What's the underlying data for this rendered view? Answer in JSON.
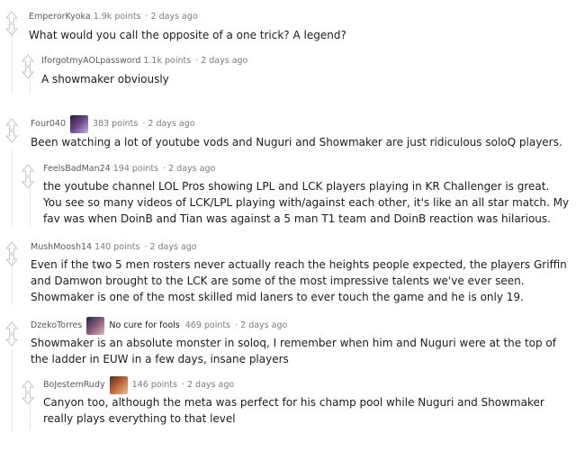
{
  "comments": [
    {
      "author": "EmperorKyoka",
      "points": "1.9k points",
      "time": "2 days ago",
      "lines": [
        "What would you call the opposite of a one trick? A legend?"
      ]
    },
    {
      "author": "IforgotmyAOLpassword",
      "points": "1.1k points",
      "time": "2 days ago",
      "lines": [
        "A showmaker obviously"
      ]
    },
    {
      "author": "Four040",
      "points": "383 points",
      "time": "2 days ago",
      "lines": [
        "Been watching a lot of youtube vods and Nuguri and Showmaker are just ridiculous soloQ players."
      ]
    },
    {
      "author": "FeelsBadMan24",
      "points": "194 points",
      "time": "2 days ago",
      "lines": [
        "the youtube channel LOL Pros showing LPL and LCK players playing in KR Challenger is great.",
        "You see so many videos of LCK/LPL playing with/against each other, it's like an all star match. My",
        "fav was when DoinB and Tian was against a 5 man T1 team and DoinB reaction was hilarious."
      ]
    },
    {
      "author": "MushMoosh14",
      "points": "140 points",
      "time": "2 days ago",
      "lines": [
        "Even if the two 5 men rosters never actually reach the heights people expected, the players Griffin",
        "and Damwon brought to the LCK are some of the most impressive talents we've ever seen.",
        "Showmaker is one of the most skilled mid laners to ever touch the game and he is only 19."
      ]
    },
    {
      "author": "DzekoTorres",
      "flair": "No cure for fools",
      "points": "469 points",
      "time": "2 days ago",
      "lines": [
        "Showmaker is an absolute monster in soloq, I remember when him and Nuguri were at the top of",
        "the ladder in EUW in a few days, insane players"
      ]
    },
    {
      "author": "BoJestemRudy",
      "points": "146 points",
      "time": "2 days ago",
      "lines": [
        "Canyon too, although the meta was perfect for his champ pool while Nuguri and Showmaker",
        "really plays everything to that level"
      ]
    }
  ],
  "separator": "·",
  "colors": {
    "arrow": "#c6c6c6",
    "thread_line": "#e6e6e6",
    "meta": "#7c7c7c"
  }
}
